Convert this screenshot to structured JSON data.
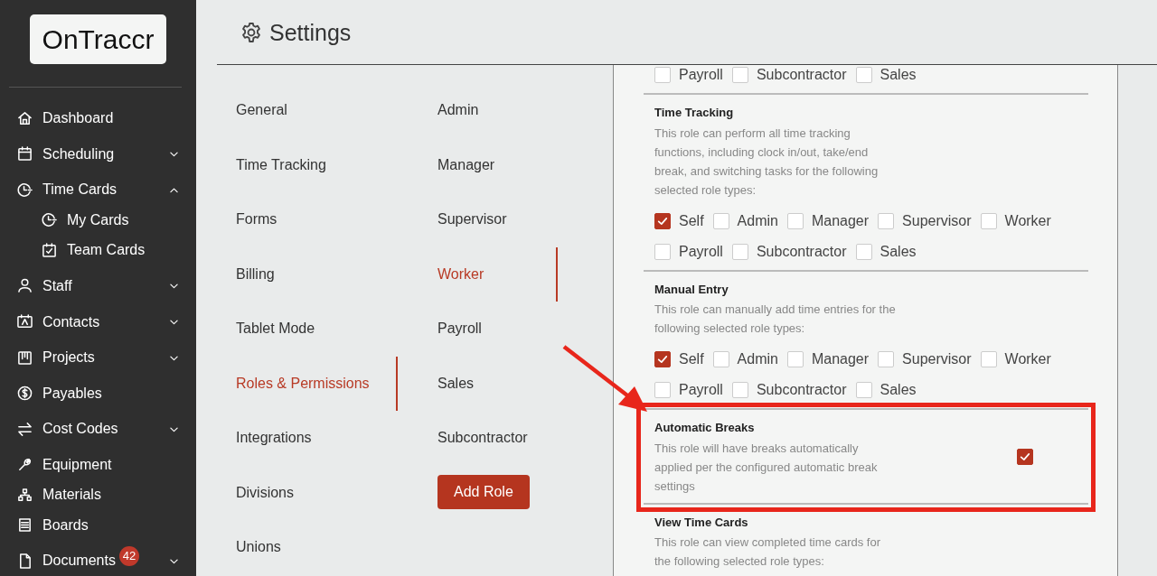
{
  "logo": {
    "text": "OnTraccr"
  },
  "sidebar": {
    "items": [
      {
        "label": "Dashboard"
      },
      {
        "label": "Scheduling",
        "expanded": false
      },
      {
        "label": "Time Cards",
        "expanded": true,
        "children": [
          {
            "label": "My Cards"
          },
          {
            "label": "Team Cards"
          }
        ]
      },
      {
        "label": "Staff",
        "expanded": false
      },
      {
        "label": "Contacts",
        "expanded": false
      },
      {
        "label": "Projects",
        "expanded": false
      },
      {
        "label": "Payables"
      },
      {
        "label": "Cost Codes",
        "expanded": false
      },
      {
        "label": "Equipment"
      },
      {
        "label": "Materials"
      },
      {
        "label": "Boards"
      },
      {
        "label": "Documents",
        "expanded": false,
        "badge": "42"
      }
    ]
  },
  "header": {
    "title": "Settings"
  },
  "settings_menu": [
    {
      "label": "General",
      "selected": false
    },
    {
      "label": "Time Tracking",
      "selected": false
    },
    {
      "label": "Forms",
      "selected": false
    },
    {
      "label": "Billing",
      "selected": false
    },
    {
      "label": "Tablet Mode",
      "selected": false
    },
    {
      "label": "Roles & Permissions",
      "selected": true
    },
    {
      "label": "Integrations",
      "selected": false
    },
    {
      "label": "Divisions",
      "selected": false
    },
    {
      "label": "Unions",
      "selected": false
    }
  ],
  "roles": [
    {
      "label": "Admin",
      "selected": false
    },
    {
      "label": "Manager",
      "selected": false
    },
    {
      "label": "Supervisor",
      "selected": false
    },
    {
      "label": "Worker",
      "selected": true
    },
    {
      "label": "Payroll",
      "selected": false
    },
    {
      "label": "Sales",
      "selected": false
    },
    {
      "label": "Subcontractor",
      "selected": false
    }
  ],
  "add_role_button": "Add Role",
  "permissions": [
    {
      "kind": "roles",
      "highlighted": false,
      "options": [
        {
          "label": "Payroll",
          "checked": false
        },
        {
          "label": "Subcontractor",
          "checked": false
        },
        {
          "label": "Sales",
          "checked": false
        }
      ]
    },
    {
      "kind": "roles",
      "highlighted": false,
      "title": "Time Tracking",
      "description": "This role can perform all time tracking functions, including clock in/out, take/end break, and switching tasks for the following selected role types:",
      "options": [
        {
          "label": "Self",
          "checked": true
        },
        {
          "label": "Admin",
          "checked": false
        },
        {
          "label": "Manager",
          "checked": false
        },
        {
          "label": "Supervisor",
          "checked": false
        },
        {
          "label": "Worker",
          "checked": false
        },
        {
          "label": "Payroll",
          "checked": false
        },
        {
          "label": "Subcontractor",
          "checked": false
        },
        {
          "label": "Sales",
          "checked": false
        }
      ]
    },
    {
      "kind": "roles",
      "highlighted": false,
      "title": "Manual Entry",
      "description": "This role can manually add time entries for the following selected role types:",
      "options": [
        {
          "label": "Self",
          "checked": true
        },
        {
          "label": "Admin",
          "checked": false
        },
        {
          "label": "Manager",
          "checked": false
        },
        {
          "label": "Supervisor",
          "checked": false
        },
        {
          "label": "Worker",
          "checked": false
        },
        {
          "label": "Payroll",
          "checked": false
        },
        {
          "label": "Subcontractor",
          "checked": false
        },
        {
          "label": "Sales",
          "checked": false
        }
      ]
    },
    {
      "kind": "toggle",
      "highlighted": true,
      "title": "Automatic Breaks",
      "description": "This role will have breaks automatically applied per the configured automatic break settings",
      "checked": true
    },
    {
      "kind": "roles",
      "highlighted": false,
      "title": "View Time Cards",
      "description": "This role can view completed time cards for the following selected role types:"
    }
  ]
}
